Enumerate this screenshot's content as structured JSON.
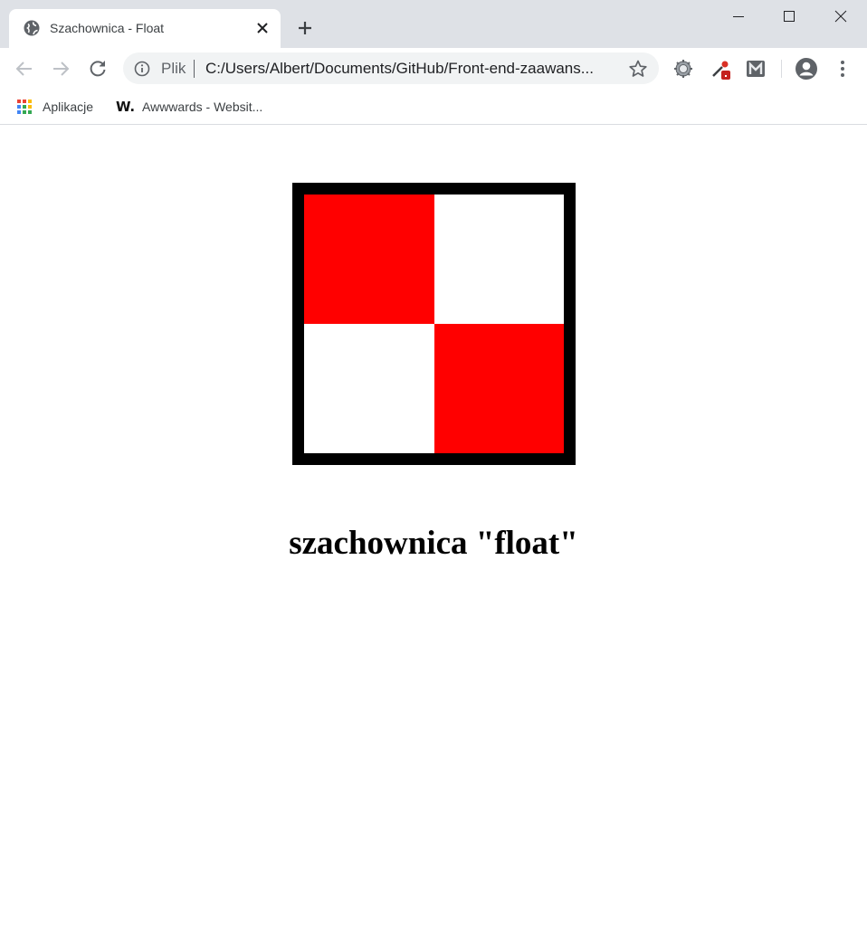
{
  "browser": {
    "tab": {
      "title": "Szachownica - Float"
    },
    "address_bar": {
      "scheme_label": "Plik",
      "url": "C:/Users/Albert/Documents/GitHub/Front-end-zaawans..."
    },
    "bookmarks": [
      {
        "label": "Aplikacje",
        "icon": "apps-grid-icon"
      },
      {
        "label": "Awwwards - Websit...",
        "icon": "awwwards-icon"
      }
    ],
    "extensions": [
      "gear-extension-icon",
      "eyedropper-extension-icon",
      "m-extension-icon"
    ]
  },
  "page": {
    "board": {
      "border_color": "#000000",
      "cells": [
        {
          "color": "#ff0000"
        },
        {
          "color": "#ffffff"
        },
        {
          "color": "#ffffff"
        },
        {
          "color": "#ff0000"
        }
      ]
    },
    "heading": "szachownica \"float\""
  }
}
